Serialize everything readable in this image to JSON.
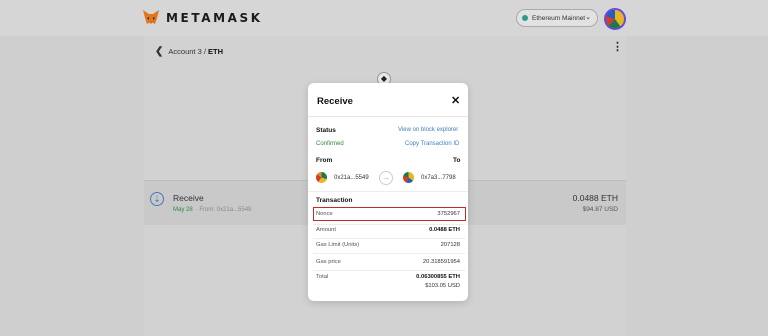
{
  "header": {
    "brand": "METAMASK",
    "network": "Ethereum Mainnet",
    "network_color": "#2a9d8f"
  },
  "page": {
    "account": "Account 3 / ",
    "asset": "ETH",
    "kebab": "⋮",
    "back_glyph": "❮",
    "eth_glyph": "◆"
  },
  "activity": {
    "title": "Receive",
    "date": "May 28",
    "from": "· From: 0x21a...5549",
    "amount": "0.0488 ETH",
    "usd": "$94.87 USD",
    "icon_glyph": "⇣"
  },
  "modal": {
    "title": "Receive",
    "close": "✕",
    "status_label": "Status",
    "status_value": "Confirmed",
    "view_link": "View on block explorer",
    "copy_link": "Copy Transaction ID",
    "from_label": "From",
    "to_label": "To",
    "from_addr": "0x21a...5549",
    "to_addr": "0x7a3...7798",
    "arrow_glyph": "→",
    "transaction_label": "Transaction",
    "rows": [
      {
        "label": "Nonce",
        "value": "3752967"
      },
      {
        "label": "Amount",
        "value": "0.0488 ETH"
      },
      {
        "label": "Gas Limit (Units)",
        "value": "207128"
      },
      {
        "label": "Gas price",
        "value": "20.318591954"
      },
      {
        "label": "Total",
        "value": "0.06300855 ETH"
      }
    ],
    "total_usd": "$103.05 USD",
    "highlight_color": "#c42a2a"
  }
}
